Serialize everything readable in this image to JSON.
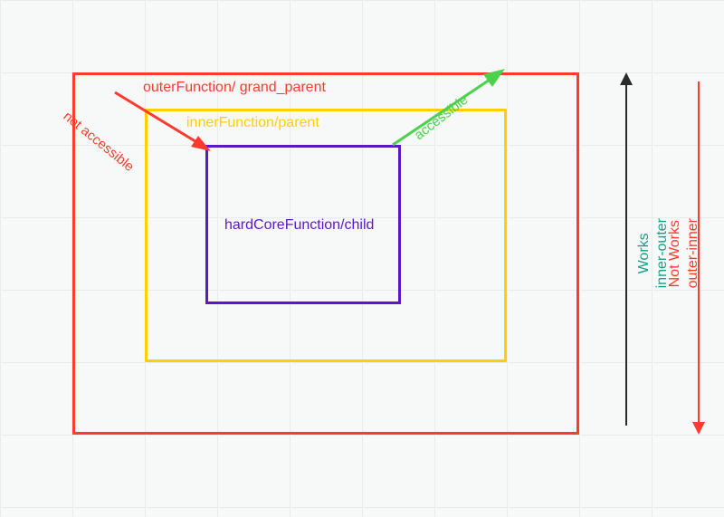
{
  "boxes": {
    "outer": "outerFunction/ grand_parent",
    "middle": "innerFunction/parent",
    "inner": "hardCoreFunction/child"
  },
  "diagonals": {
    "not_accessible": "not accessible",
    "accessible": "accessible"
  },
  "right": {
    "works_title": "Works",
    "works_sub": "inner-outer",
    "notworks_title": "Not Works",
    "notworks_sub": "outer-inner"
  },
  "colors": {
    "outer": "#ff3b2f",
    "middle": "#ffd000",
    "inner": "#5e17c7",
    "accessible": "#4bd14b",
    "works": "#1a9d86",
    "notworks": "#ff3b2f",
    "black": "#2a2a2a"
  }
}
